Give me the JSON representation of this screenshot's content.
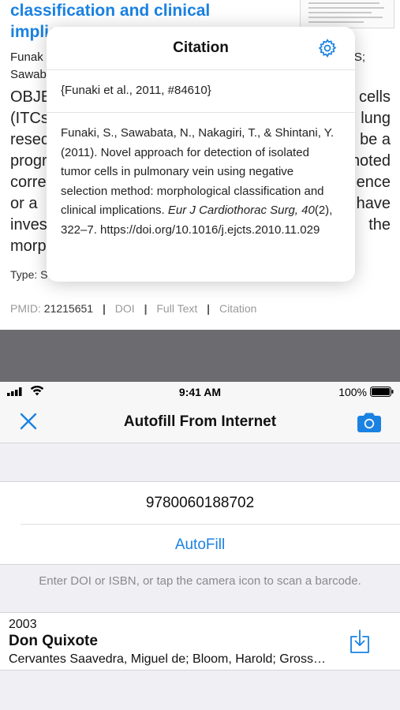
{
  "reference": {
    "title_line1": "classification and clinical",
    "title_line2": "implic",
    "authors_line1": "Funak",
    "authors_line1_right": "S;",
    "authors_line2": "Sawab",
    "abstract_rows": [
      {
        "left": "OBJE",
        "right": "cells"
      },
      {
        "left": "(ITCs",
        "right": "lung"
      },
      {
        "left": "resec",
        "right": "be a"
      },
      {
        "left": "progr",
        "right": "noted"
      },
      {
        "left": "corre",
        "right": "ence"
      },
      {
        "left": "or a",
        "right": "have"
      },
      {
        "left": "inves",
        "right": "the"
      },
      {
        "left": "morp",
        "right": ""
      }
    ],
    "type_label": "Type: S",
    "pmid_label": "PMID:",
    "pmid_value": "21215651",
    "link_doi": "DOI",
    "link_fulltext": "Full Text",
    "link_citation": "Citation"
  },
  "citation_popover": {
    "title": "Citation",
    "short_citation": "{Funaki et al., 2011, #84610}",
    "full_pre": "Funaki, S., Sawabata, N., Nakagiri, T., & Shintani, Y. (2011). Novel approach for detection of isolated tumor cells in pulmonary vein using negative selection method: morphological classification and clinical implications. ",
    "journal_volume": "Eur J Cardiothorac Surg, 40",
    "full_post": "(2), 322–7. https://doi.org/10.1016/j.ejcts.2010.11.029"
  },
  "status_bar": {
    "time": "9:41 AM",
    "battery": "100%"
  },
  "nav": {
    "title": "Autofill From Internet"
  },
  "form": {
    "identifier_value": "9780060188702",
    "autofill_label": "AutoFill",
    "hint": "Enter DOI or ISBN, or tap the camera icon to scan a barcode."
  },
  "result": {
    "year": "2003",
    "title": "Don Quixote",
    "authors": "Cervantes Saavedra, Miguel de; Bloom, Harold; Grossman, Edith"
  },
  "colors": {
    "accent": "#1a82e2",
    "background": "#efeff4",
    "separator_band": "#6c6c70"
  }
}
